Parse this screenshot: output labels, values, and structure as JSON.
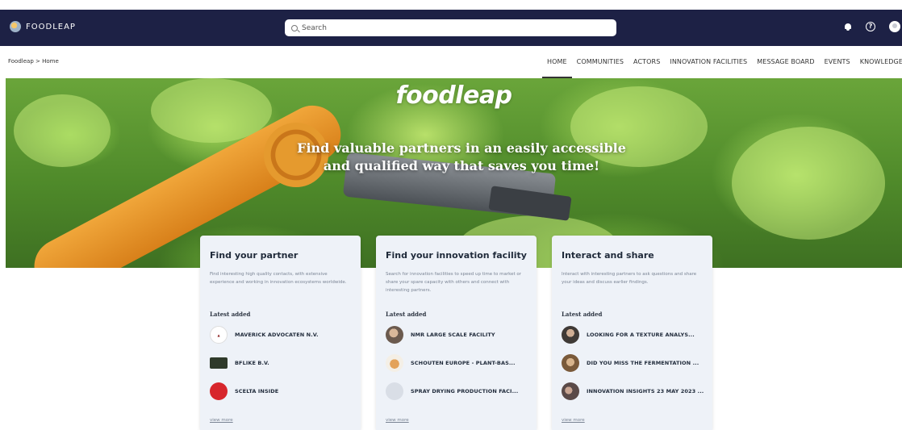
{
  "topbar": {
    "brand": "FOODLEAP",
    "search_placeholder": "Search",
    "icons": [
      "bell-icon",
      "help-icon",
      "user-icon"
    ],
    "help_glyph": "?",
    "color": "#1d2145"
  },
  "breadcrumb": "Foodleap > Home",
  "nav": {
    "items": [
      "HOME",
      "COMMUNITIES",
      "ACTORS",
      "INNOVATION FACILITIES",
      "MESSAGE BOARD",
      "EVENTS",
      "KNOWLEDGE BAS"
    ],
    "active": "HOME"
  },
  "hero": {
    "logo": "foodleap",
    "title_line1": "Find valuable partners in an easily accessible",
    "title_line2": "and qualified way that saves you time!"
  },
  "cards": [
    {
      "title": "Find your partner",
      "description": "Find interesting high quality contacts, with extensive experience and working in innovation ecosystems worldwide.",
      "latest_label": "Latest added",
      "items": [
        {
          "label": "MAVERICK ADVOCATEN N.V.",
          "avatar": "maverick-logo",
          "avatar_color": "#ffffff"
        },
        {
          "label": "BFLIKE B.V.",
          "avatar": "bflike-logo",
          "avatar_color": "#2f3a2a"
        },
        {
          "label": "SCELTA INSIDE",
          "avatar": "inside-logo",
          "avatar_color": "#d7262c"
        }
      ],
      "view_more": "view more"
    },
    {
      "title": "Find your innovation facility",
      "description": "Search for innovation facilities to speed up time to market or share your spare capacity with others and connect with interesting partners.",
      "latest_label": "Latest added",
      "items": [
        {
          "label": "NMR LARGE SCALE FACILITY",
          "avatar": "person-photo",
          "avatar_color": "#6b5a4e"
        },
        {
          "label": "SCHOUTEN EUROPE - PLANT-BAS...",
          "avatar": "food-photo",
          "avatar_color": "#c9783a"
        },
        {
          "label": "SPRAY DRYING PRODUCTION FACI...",
          "avatar": "placeholder-avatar",
          "avatar_color": "#d9dee6"
        }
      ],
      "view_more": "view more"
    },
    {
      "title": "Interact and share",
      "description": "Interact with interesting partners to ask questions and share your ideas and discuss earlier findings.",
      "latest_label": "Latest added",
      "items": [
        {
          "label": "LOOKING FOR A TEXTURE ANALYS...",
          "avatar": "person-photo",
          "avatar_color": "#3f3a36"
        },
        {
          "label": "DID YOU MISS THE FERMENTATION ...",
          "avatar": "person-photo",
          "avatar_color": "#7a5a3a"
        },
        {
          "label": "INNOVATION INSIGHTS 23 MAY 2023 ...",
          "avatar": "group-photo",
          "avatar_color": "#5a4a48"
        }
      ],
      "view_more": "view more"
    }
  ]
}
